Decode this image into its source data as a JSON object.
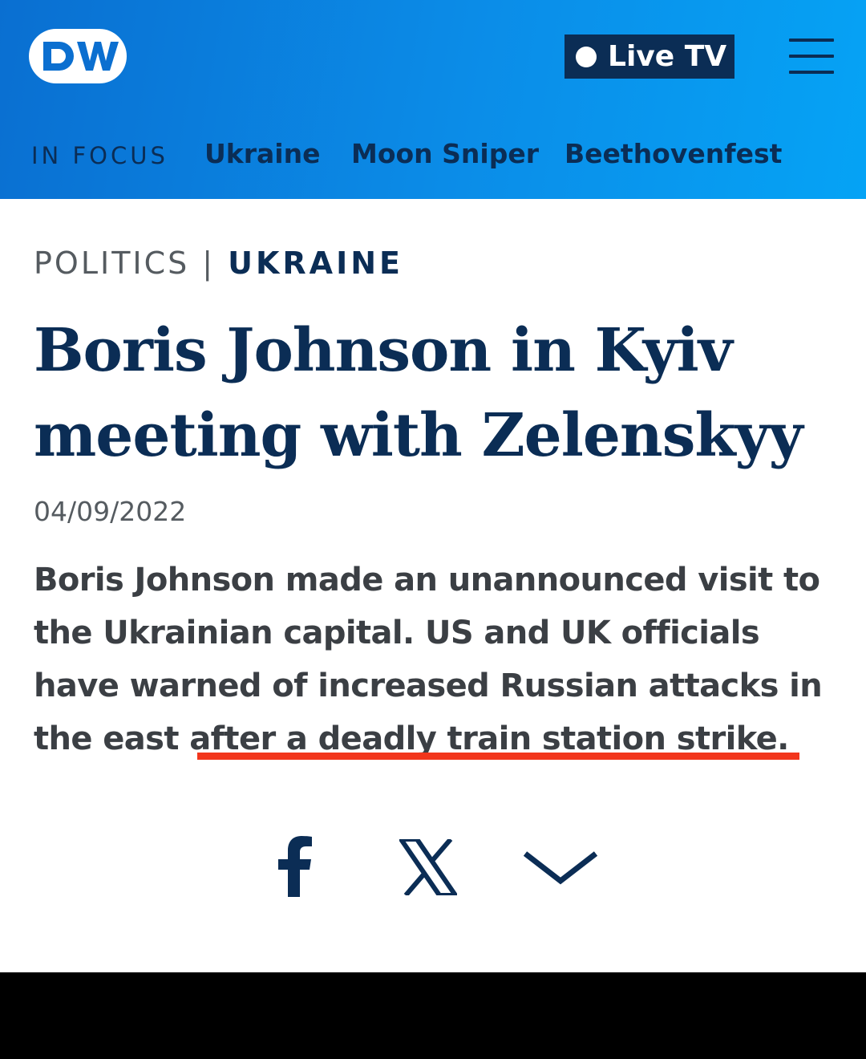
{
  "header": {
    "logo_text": "DW",
    "live_label": "Live TV",
    "menu_icon": "hamburger-icon",
    "focus_label": "IN FOCUS",
    "focus_links": [
      "Ukraine",
      "Moon Sniper",
      "Beethovenfest"
    ]
  },
  "article": {
    "category": "POLITICS",
    "separator": "|",
    "topic": "UKRAINE",
    "headline": "Boris Johnson in Kyiv meeting with Zelenskyy",
    "date": "04/09/2022",
    "teaser": "Boris Johnson made an unannounced visit to the Ukrainian capital. US and UK officials have warned of increased Russian attacks in the east after a deadly train station strike."
  },
  "share": {
    "icons": [
      "facebook-icon",
      "x-icon",
      "chevron-down-icon"
    ]
  },
  "colors": {
    "header_start": "#0a6fd1",
    "header_end": "#05a3f5",
    "navy": "#0b2d55",
    "highlight": "#f2361c"
  }
}
